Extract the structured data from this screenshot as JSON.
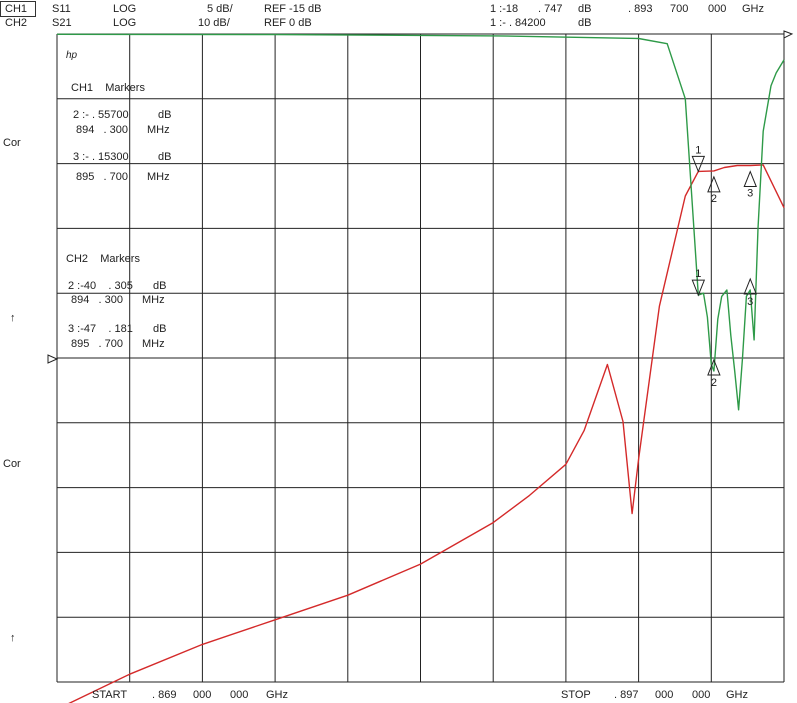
{
  "header": {
    "row1": {
      "channel": "CH1",
      "param": "S11",
      "format": "LOG",
      "scale": "5 dB/",
      "ref": "REF -15 dB",
      "marker_num": "1 :-18",
      "marker_val": ". 747",
      "marker_unit": "dB",
      "freq_a": ". 893",
      "freq_b": "700",
      "freq_c": "000",
      "freq_unit": "GHz"
    },
    "row2": {
      "channel": "CH2",
      "param": "S21",
      "format": "LOG",
      "scale": "10 dB/",
      "ref": "REF 0 dB",
      "marker_num": "1 :- . 84200",
      "marker_unit": "dB"
    }
  },
  "left_labels": {
    "cor_upper": "Cor",
    "arrow_upper": "↑",
    "cor_lower": "Cor",
    "arrow_lower": "↑"
  },
  "hp_logo": "hp",
  "ch1_markers": {
    "title": "CH1    Markers",
    "m2_val": "2 :- . 55700",
    "m2_unit": "dB",
    "m2_freq": "894   . 300",
    "m2_freq_unit": "MHz",
    "m3_val": "3 :- . 15300",
    "m3_unit": "dB",
    "m3_freq": "895   . 700",
    "m3_freq_unit": "MHz"
  },
  "ch2_markers": {
    "title": "CH2    Markers",
    "m2_val": "2 :-40    . 305",
    "m2_unit": "dB",
    "m2_freq": "894   . 300",
    "m2_freq_unit": "MHz",
    "m3_val": "3 :-47    . 181",
    "m3_unit": "dB",
    "m3_freq": "895   . 700",
    "m3_freq_unit": "MHz"
  },
  "footer": {
    "start_label": "START",
    "start_a": ". 869",
    "start_b": "000",
    "start_c": "000",
    "start_unit": "GHz",
    "stop_label": "STOP",
    "stop_a": ". 897",
    "stop_b": "000",
    "stop_c": "000",
    "stop_unit": "GHz"
  },
  "marker_labels": {
    "m1": "1",
    "m2": "2",
    "m3": "3"
  },
  "colors": {
    "ch1_trace": "#d42a2a",
    "ch2_trace": "#2e9a48",
    "grid": "#222222"
  },
  "chart_data": {
    "type": "line",
    "x_unit": "GHz",
    "xlim": [
      0.869,
      0.897
    ],
    "x_divisions": 10,
    "y_divisions": 10,
    "grid": true,
    "series": [
      {
        "name": "S11",
        "channel": "CH1",
        "color": "#d42a2a",
        "scale_db_per_div": 5,
        "ref_db": -15,
        "ref_position_div_from_top": 5,
        "x": [
          0.869,
          0.8718,
          0.8746,
          0.8774,
          0.8802,
          0.883,
          0.8858,
          0.8872,
          0.8886,
          0.8893,
          0.8902,
          0.8908,
          0.89115,
          0.8914,
          0.8922,
          0.8932,
          0.8937,
          0.8943,
          0.8947,
          0.8952,
          0.8957,
          0.8962,
          0.897
        ],
        "y": [
          -42.1,
          -39.4,
          -37.1,
          -35.2,
          -33.3,
          -30.9,
          -27.7,
          -25.6,
          -23.2,
          -20.6,
          -15.5,
          -19.9,
          -27.0,
          -22.8,
          -11.0,
          -2.5,
          -0.6,
          -0.56,
          -0.3,
          -0.15,
          -0.15,
          -0.1,
          -3.4
        ]
      },
      {
        "name": "S21",
        "channel": "CH2",
        "color": "#2e9a48",
        "scale_db_per_div": 10,
        "ref_db": 0,
        "ref_position_div_from_top": 0,
        "x": [
          0.869,
          0.8774,
          0.886,
          0.8914,
          0.8925,
          0.8932,
          0.8937,
          0.8939,
          0.89405,
          0.8942,
          0.8943,
          0.89445,
          0.8946,
          0.8948,
          0.89495,
          0.8951,
          0.89525,
          0.8954,
          0.89555,
          0.8957,
          0.89585,
          0.896,
          0.8962,
          0.8965,
          0.8967,
          0.897
        ],
        "y": [
          -0.05,
          -0.1,
          -0.3,
          -0.7,
          -1.5,
          -10.0,
          -40.3,
          -40.0,
          -43.7,
          -51.0,
          -52.0,
          -44.0,
          -40.5,
          -39.5,
          -46.5,
          -52.0,
          -58.0,
          -50.0,
          -40.5,
          -39.5,
          -47.2,
          -30.0,
          -15.0,
          -8.0,
          -6.0,
          -4.0
        ]
      }
    ],
    "markers": [
      {
        "label": "1",
        "x": 0.8937,
        "ch1_db": -18.747,
        "ch2_db": -0.842
      },
      {
        "label": "2",
        "x": 0.8943,
        "ch1_db": -0.557,
        "ch2_db": -40.305
      },
      {
        "label": "3",
        "x": 0.8957,
        "ch1_db": -0.153,
        "ch2_db": -47.181
      }
    ]
  }
}
